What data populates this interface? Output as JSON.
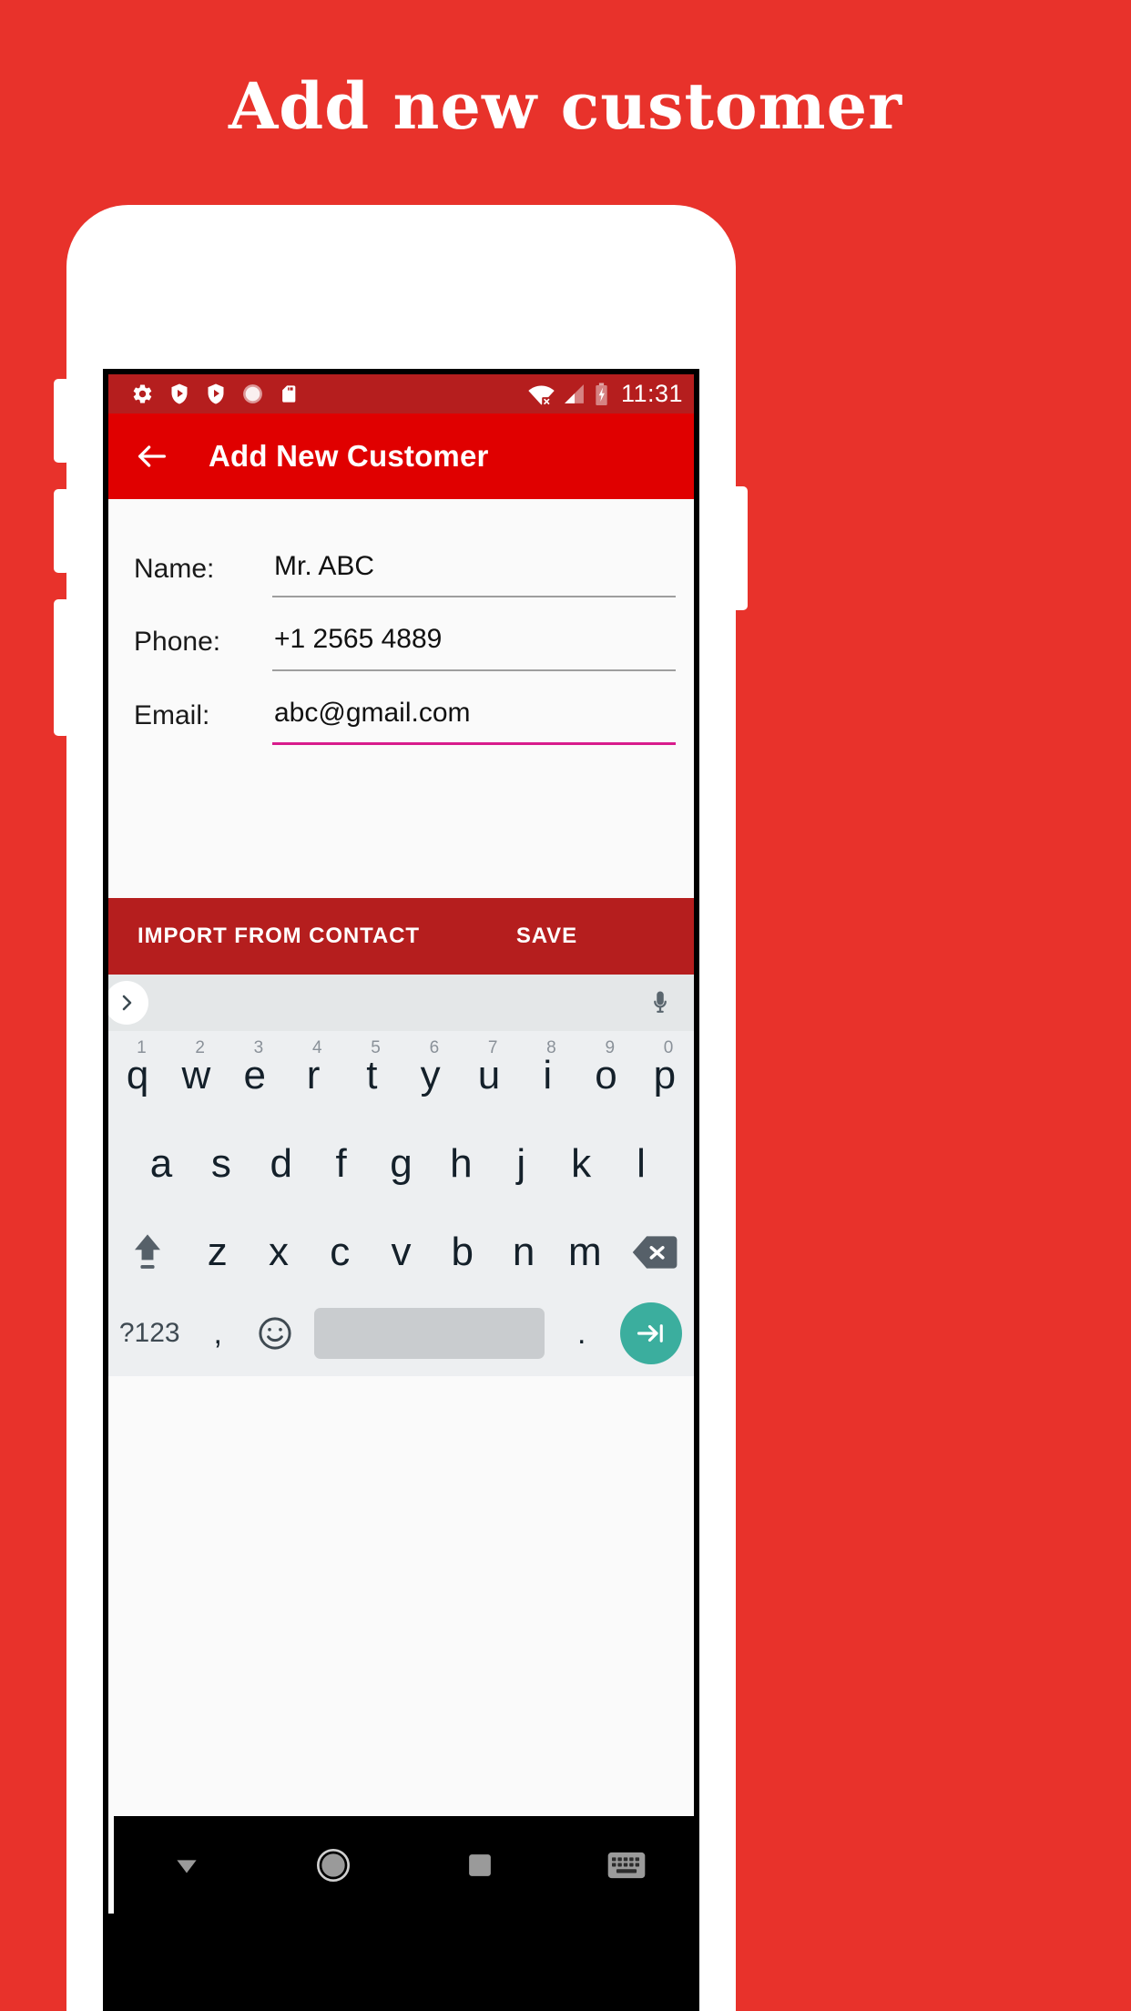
{
  "promo": {
    "title": "Add new customer"
  },
  "colors": {
    "background": "#E8322B",
    "app_bar": "#E00000",
    "status_bar": "#B51E1E",
    "action_bar": "#B51E1E",
    "focus_underline": "#D81B8C",
    "enter_key": "#3BAE9E"
  },
  "status_bar": {
    "icons": [
      "gear-icon",
      "shield-play-icon",
      "shield-play-icon",
      "circle-dotted-icon",
      "sd-card-icon"
    ],
    "wifi": "wifi-off-icon",
    "signal": "signal-icon",
    "battery": "battery-charging-icon",
    "clock": "11:31"
  },
  "app_bar": {
    "back": "back-arrow-icon",
    "title": "Add New Customer"
  },
  "form": {
    "fields": [
      {
        "label": "Name:",
        "value": "Mr. ABC",
        "focused": false
      },
      {
        "label": "Phone:",
        "value": "+1 2565 4889",
        "focused": false
      },
      {
        "label": "Email:",
        "value": "abc@gmail.com",
        "focused": true
      }
    ]
  },
  "actions": {
    "import_label": "IMPORT FROM CONTACT",
    "save_label": "SAVE"
  },
  "keyboard": {
    "suggest": {
      "expand": "chevron-right-icon",
      "mic": "microphone-icon"
    },
    "row1": [
      {
        "key": "q",
        "hint": "1"
      },
      {
        "key": "w",
        "hint": "2"
      },
      {
        "key": "e",
        "hint": "3"
      },
      {
        "key": "r",
        "hint": "4"
      },
      {
        "key": "t",
        "hint": "5"
      },
      {
        "key": "y",
        "hint": "6"
      },
      {
        "key": "u",
        "hint": "7"
      },
      {
        "key": "i",
        "hint": "8"
      },
      {
        "key": "o",
        "hint": "9"
      },
      {
        "key": "p",
        "hint": "0"
      }
    ],
    "row2": [
      "a",
      "s",
      "d",
      "f",
      "g",
      "h",
      "j",
      "k",
      "l"
    ],
    "row3": [
      "z",
      "x",
      "c",
      "v",
      "b",
      "n",
      "m"
    ],
    "shift": "shift-icon",
    "backspace": "backspace-icon",
    "row4": {
      "symbols": "?123",
      "comma": ",",
      "emoji": "emoji-icon",
      "space": "",
      "period": ".",
      "enter": "next-field-icon"
    }
  },
  "nav_bar": {
    "items": [
      "keyboard-down-icon",
      "home-icon",
      "recents-icon",
      "keyboard-switch-icon"
    ]
  }
}
